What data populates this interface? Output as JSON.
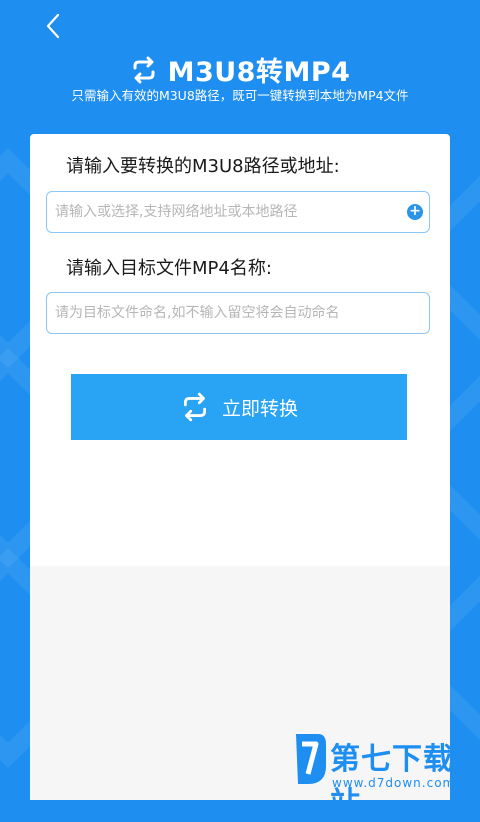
{
  "header": {
    "title": "M3U8转MP4",
    "subtitle": "只需输入有效的M3U8路径，既可一键转换到本地为MP4文件"
  },
  "form": {
    "source_label": "请输入要转换的M3U8路径或地址:",
    "source_placeholder": "请输入或选择,支持网络地址或本地路径",
    "target_label": "请输入目标文件MP4名称:",
    "target_placeholder": "请为目标文件命名,如不输入留空将会自动命名",
    "convert_label": "立即转换"
  },
  "watermark": {
    "title": "第七下载站",
    "url": "www.d7down.com"
  },
  "icons": {
    "back": "chevron-left-icon",
    "title": "repeat-icon",
    "add": "plus-circle-icon",
    "convert": "repeat-icon"
  },
  "colors": {
    "primary": "#1e8ef0",
    "button": "#29a3f3",
    "input_border": "#8bc6f5"
  }
}
